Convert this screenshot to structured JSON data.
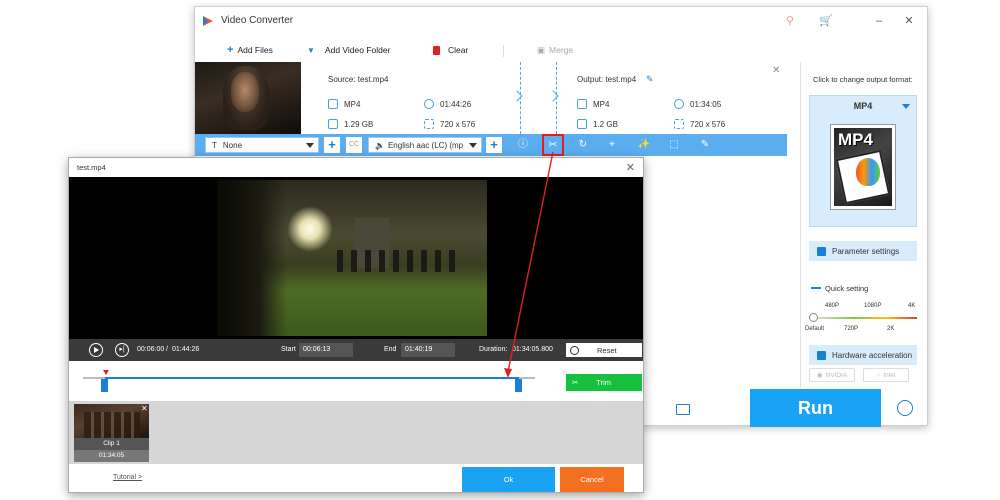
{
  "app": {
    "title": "Video Converter",
    "icons": [
      "app-logo-icon",
      "key-icon",
      "cart-icon",
      "minimize-icon",
      "close-icon"
    ],
    "colors": {
      "accent": "#1aa3f5",
      "edit_bar": "#5aaef0",
      "highlight": "#e02020",
      "trim_green": "#16c13d",
      "cancel_orange": "#f37021"
    }
  },
  "toolbar": {
    "add_files": "Add Files",
    "add_video_folder": "Add Video Folder",
    "clear": "Clear",
    "merge": "Merge"
  },
  "file": {
    "source_label": "Source: test.mp4",
    "output_label": "Output: test.mp4",
    "source_format": "MP4",
    "source_duration": "01:44:26",
    "source_size": "1.29 GB",
    "source_resolution": "720 x 576",
    "output_format": "MP4",
    "output_duration": "01:34:05",
    "output_size": "1.2 GB",
    "output_resolution": "720 x 576"
  },
  "edit_bar": {
    "subtitle_select": "None",
    "cc_label": "CC",
    "audio_select": "English aac (LC) (mp",
    "icons": [
      "info-icon",
      "scissors-icon",
      "rotate-icon",
      "crop-icon",
      "effects-icon",
      "watermark-icon",
      "edit-icon"
    ]
  },
  "right_panel": {
    "hint": "Click to change output format:",
    "format": "MP4",
    "format_tile_text": "MP4",
    "parameter_settings": "Parameter settings",
    "quick_setting": "Quick setting",
    "ticks_top": [
      "480P",
      "1080P",
      "4K"
    ],
    "ticks_bottom": [
      "Default",
      "720P",
      "2K"
    ],
    "hardware_acceleration": "Hardware acceleration",
    "nvidia": "NVIDIA",
    "intel": "Intel"
  },
  "run": {
    "label": "Run"
  },
  "trim_dialog": {
    "title": "test.mp4",
    "current_time": "00:06:00",
    "time_sep": "/",
    "total_time": "01:44:26",
    "start_label": "Start",
    "start_value": "00:06:13",
    "end_label": "End",
    "end_value": "01:40:19",
    "duration_label": "Duration:",
    "duration_value": "01:34:05.800",
    "reset_label": "Reset",
    "trim_label": "Trim",
    "clip_name": "Clip 1",
    "clip_duration": "01:34:05",
    "tutorial": "Tutorial >",
    "ok": "Ok",
    "cancel": "Cancel"
  }
}
